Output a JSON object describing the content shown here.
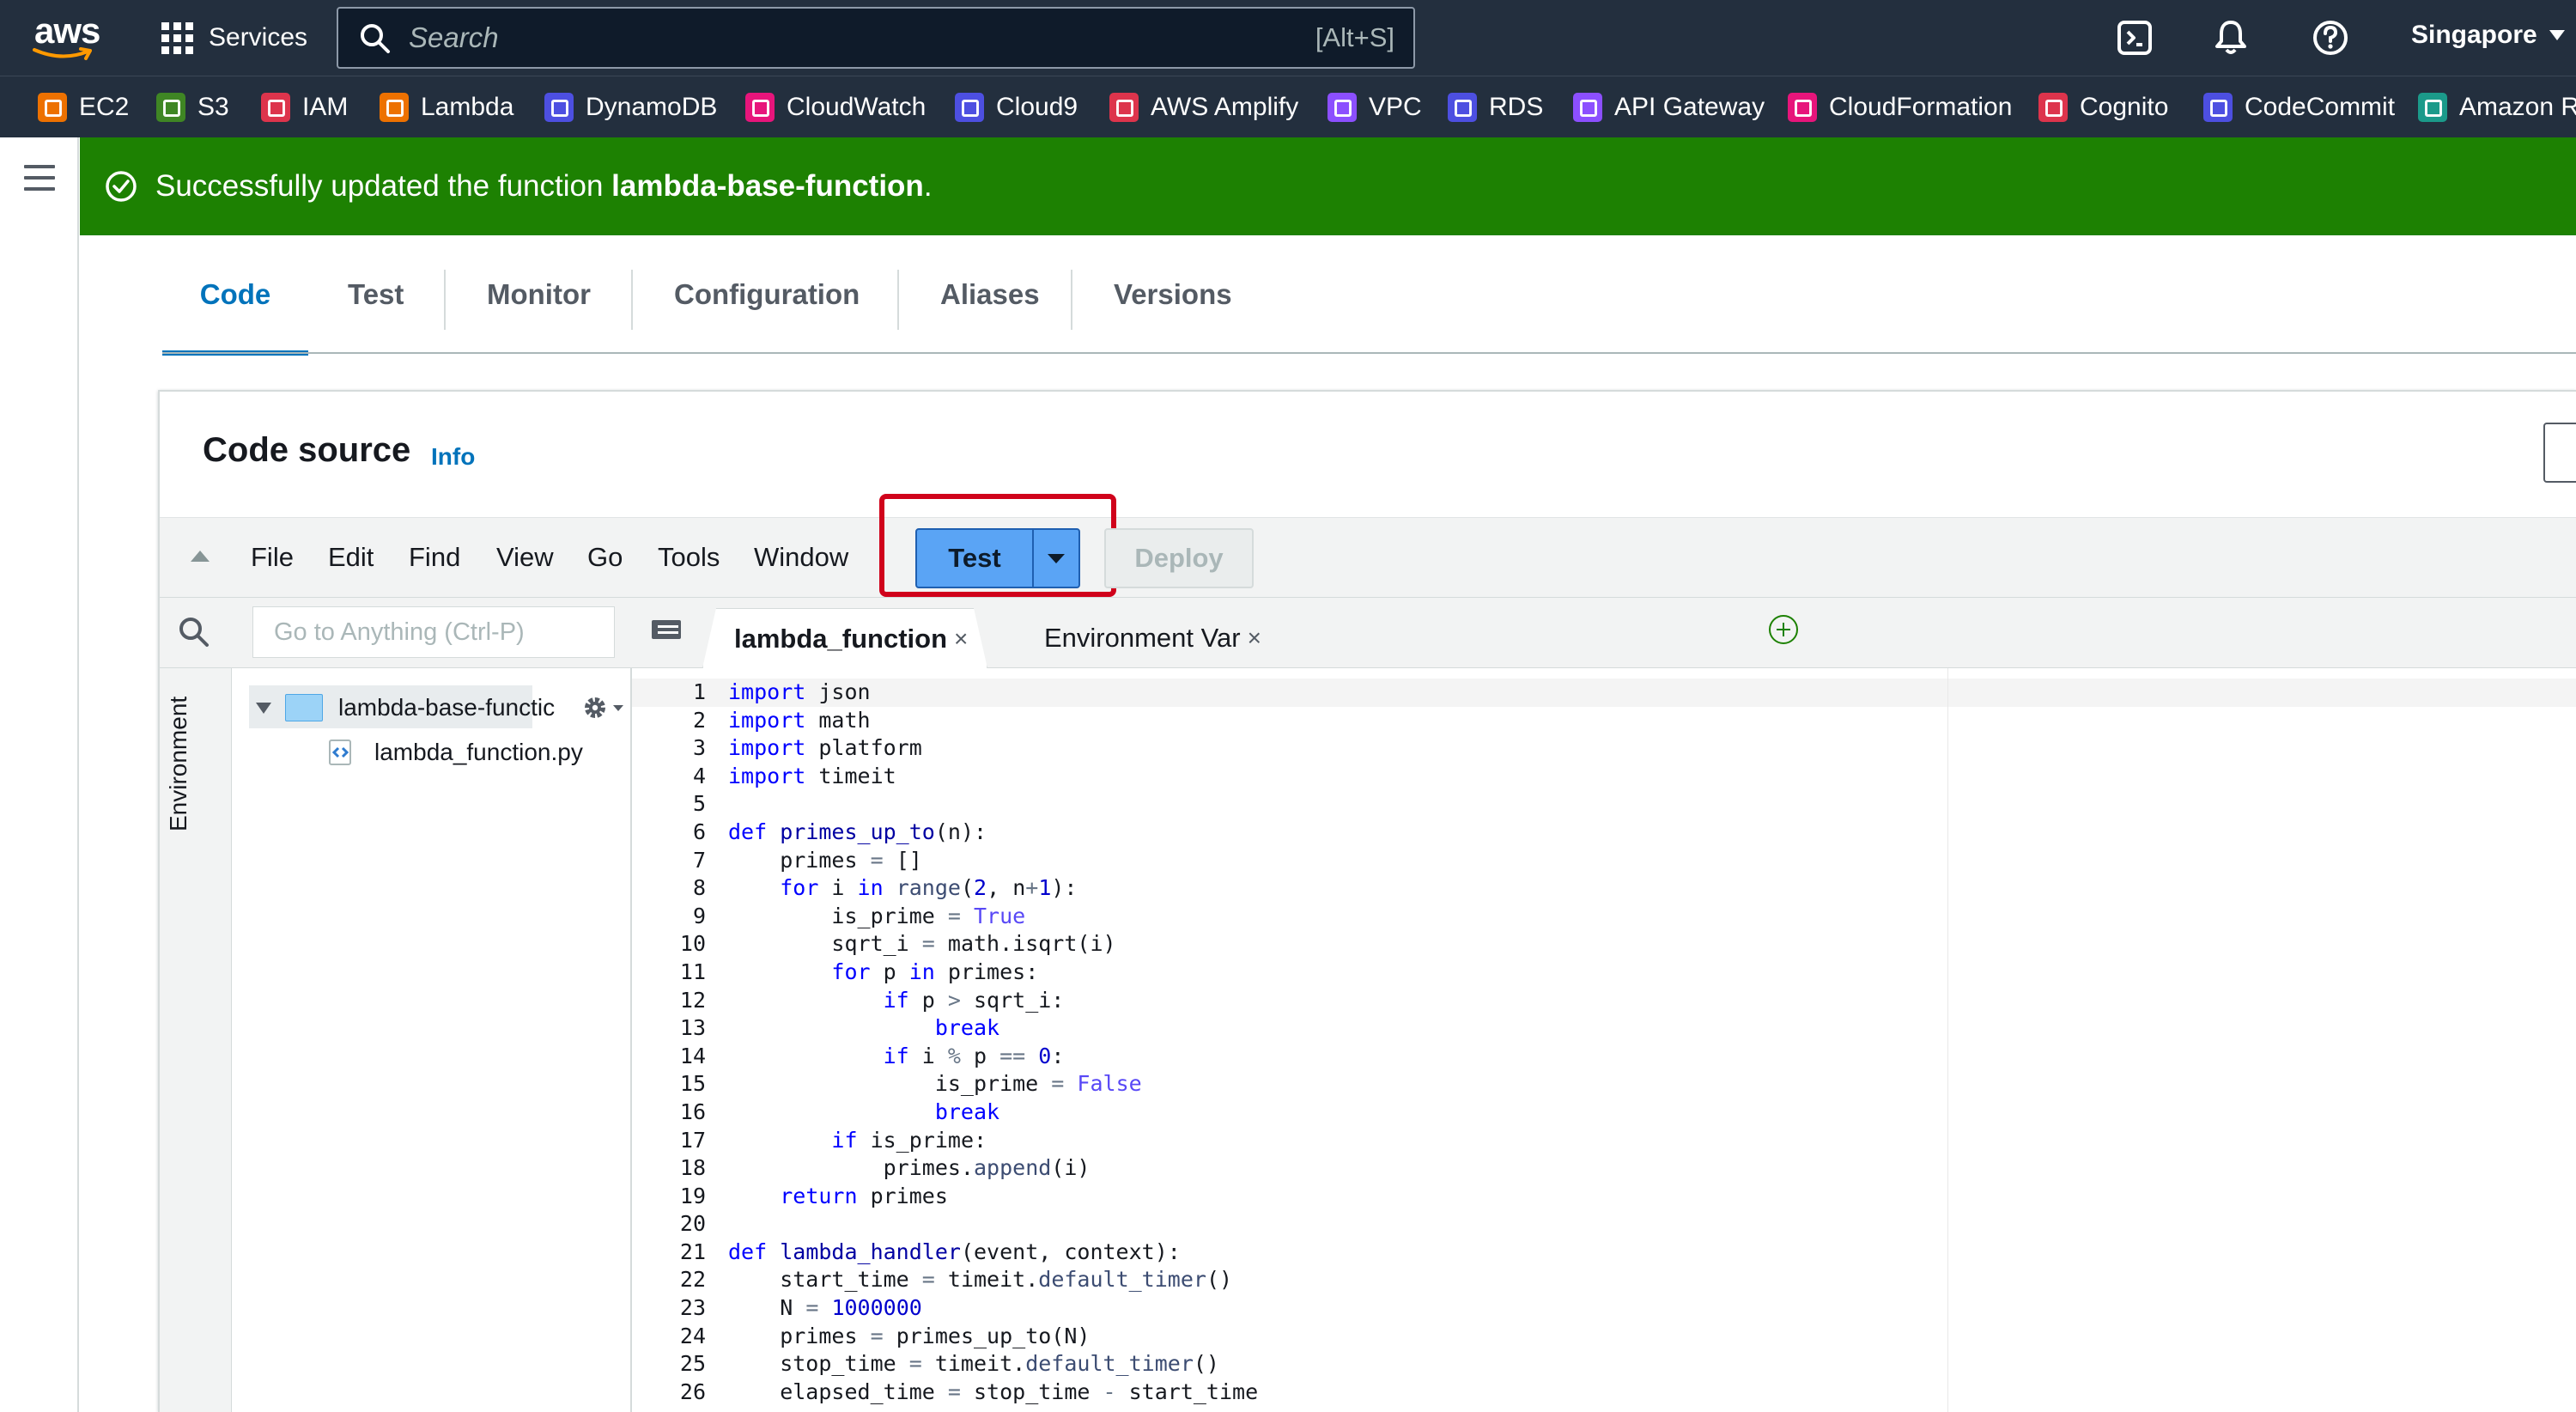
{
  "topnav": {
    "logo": "aws",
    "services_label": "Services",
    "search_placeholder": "Search",
    "search_shortcut": "[Alt+S]",
    "region": "Singapore"
  },
  "favorites": [
    {
      "label": "EC2",
      "color": "#ed7100"
    },
    {
      "label": "S3",
      "color": "#3f8624"
    },
    {
      "label": "IAM",
      "color": "#dd344c"
    },
    {
      "label": "Lambda",
      "color": "#ed7100"
    },
    {
      "label": "DynamoDB",
      "color": "#4d4fe1"
    },
    {
      "label": "CloudWatch",
      "color": "#e7157b"
    },
    {
      "label": "Cloud9",
      "color": "#4d4fe1"
    },
    {
      "label": "AWS Amplify",
      "color": "#dd344c"
    },
    {
      "label": "VPC",
      "color": "#8c4fff"
    },
    {
      "label": "RDS",
      "color": "#4d4fe1"
    },
    {
      "label": "API Gateway",
      "color": "#8c4fff"
    },
    {
      "label": "CloudFormation",
      "color": "#e7157b"
    },
    {
      "label": "Cognito",
      "color": "#dd344c"
    },
    {
      "label": "CodeCommit",
      "color": "#4d4fe1"
    },
    {
      "label": "Amazon Re",
      "color": "#1b9a8a"
    }
  ],
  "flash": {
    "prefix": "Successfully updated the function ",
    "function_name": "lambda-base-function",
    "suffix": ".",
    "color": "#1d8102"
  },
  "tabs": [
    {
      "label": "Code",
      "active": true
    },
    {
      "label": "Test"
    },
    {
      "label": "Monitor"
    },
    {
      "label": "Configuration"
    },
    {
      "label": "Aliases"
    },
    {
      "label": "Versions"
    }
  ],
  "code_source": {
    "title": "Code source",
    "info_link": "Info"
  },
  "ide": {
    "menus": [
      "File",
      "Edit",
      "Find",
      "View",
      "Go",
      "Tools",
      "Window"
    ],
    "test_button": "Test",
    "deploy_button": "Deploy",
    "goto_placeholder": "Go to Anything (Ctrl-P)",
    "environment_label": "Environment",
    "tree": {
      "folder": "lambda-base-functic",
      "file": "lambda_function.py"
    },
    "editor_tabs": [
      {
        "label": "lambda_function",
        "active": true
      },
      {
        "label": "Environment Var",
        "active": false
      }
    ],
    "line_numbers": [
      "1",
      "2",
      "3",
      "4",
      "5",
      "6",
      "7",
      "8",
      "9",
      "10",
      "11",
      "12",
      "13",
      "14",
      "15",
      "16",
      "17",
      "18",
      "19",
      "20",
      "21",
      "22",
      "23",
      "24",
      "25",
      "26"
    ]
  },
  "highlight_color": "#d0021b"
}
